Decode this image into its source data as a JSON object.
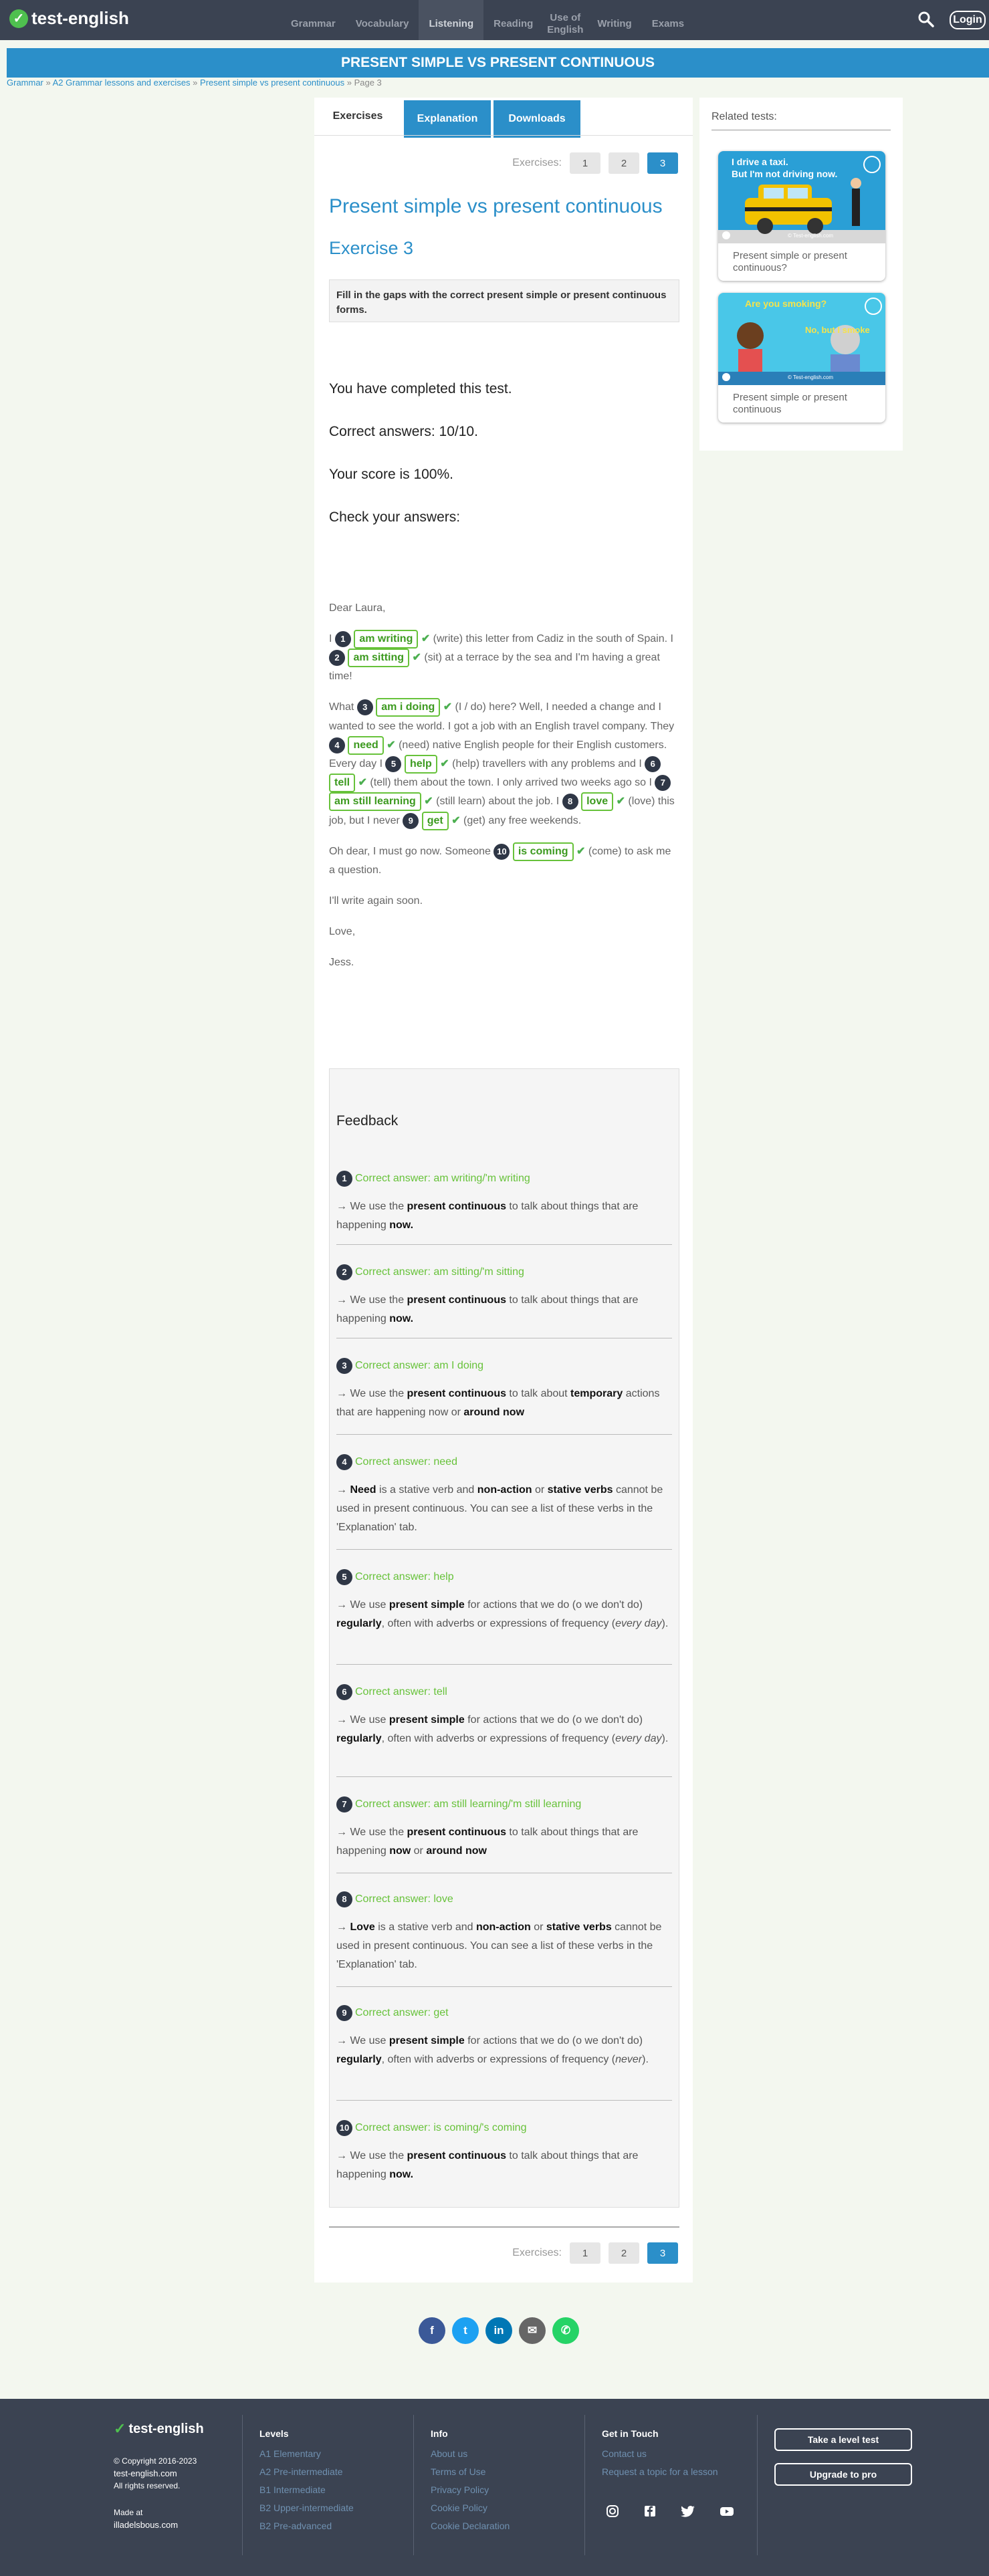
{
  "nav": {
    "logo": "test-english",
    "menu": [
      "Grammar",
      "Vocabulary",
      "Listening",
      "Reading",
      "Use of English",
      "Writing",
      "Exams"
    ],
    "active": "Listening",
    "login": "Login",
    "icons": {
      "search": "search-icon"
    }
  },
  "banner": "PRESENT SIMPLE VS PRESENT CONTINUOUS",
  "breadcrumb": {
    "items": [
      "Grammar",
      "A2 Grammar lessons and exercises",
      "Present simple vs present continuous"
    ],
    "sep": " » ",
    "current": "Page 3"
  },
  "tabs": [
    "Exercises",
    "Explanation",
    "Downloads"
  ],
  "pager": {
    "label": "Exercises:",
    "pages": [
      "1",
      "2",
      "3"
    ],
    "current": "3"
  },
  "title": "Present simple vs present continuous",
  "exercise": "Exercise 3",
  "instructions": "Fill in the gaps with the correct present simple or present continuous forms.",
  "result": {
    "completed": "You have completed this test.",
    "correct": "Correct answers: 10/10.",
    "score": "Your score is 100%.",
    "check": "Check your answers:"
  },
  "letter": {
    "greeting": "Dear Laura,",
    "p1": {
      "t1": "I ",
      "a1": "am writing",
      "h1": " (write) this letter from Cadiz in the south of Spain. I ",
      "a2": "am sitting",
      "h2": " (sit) at a terrace by the sea and I'm having a great time!"
    },
    "p2": {
      "t1": "What ",
      "a3": "am i doing",
      "h3": " (I / do) here? Well, I needed a change and I wanted to see the world. I got a job with an English travel company. They ",
      "a4": "need",
      "h4": " (need) native English people for their English customers. Every day I ",
      "a5": "help",
      "h5": " (help) travellers with any problems and I ",
      "a6": "tell",
      "h6": " (tell) them about the town. I only arrived two weeks ago so I ",
      "a7": "am still learning",
      "h7": " (still learn) about the job. I ",
      "a8": "love",
      "h8": " (love) this job, but I never ",
      "a9": "get",
      "h9": " (get) any free weekends."
    },
    "p3": {
      "t1": "Oh dear, I must go now. Someone ",
      "a10": "is coming",
      "h10": " (come) to ask me a question."
    },
    "p4": "I'll write again soon.",
    "p5": "Love,",
    "p6": "Jess."
  },
  "feedback": {
    "title": "Feedback",
    "arrow": "→",
    "items": [
      {
        "n": "1",
        "head": "Correct answer: am writing/'m writing"
      },
      {
        "n": "2",
        "head": "Correct answer: am sitting/'m sitting"
      },
      {
        "n": "3",
        "head": "Correct answer: am I doing"
      },
      {
        "n": "4",
        "head": "Correct answer: need"
      },
      {
        "n": "5",
        "head": "Correct answer: help"
      },
      {
        "n": "6",
        "head": "Correct answer: tell"
      },
      {
        "n": "7",
        "head": "Correct answer: am still learning/'m still learning"
      },
      {
        "n": "8",
        "head": "Correct answer: love"
      },
      {
        "n": "9",
        "head": "Correct answer: get"
      },
      {
        "n": "10",
        "head": "Correct answer: is coming/'s coming"
      }
    ],
    "pc_now": {
      "a": " We use the ",
      "b": "present continuous",
      "c": " to talk about things that are happening ",
      "d": "now."
    },
    "pc_temp": {
      "a": " We use the ",
      "b": "present continuous",
      "c": " to talk about ",
      "d": "temporary",
      "e": " actions that are happening now or ",
      "f": "around now"
    },
    "stative4": {
      "a": "Need",
      "b": " is a stative verb and ",
      "c": "non-action",
      "d": " or ",
      "e": "stative verbs",
      "f": " cannot be used in present continuous. You can see a list of these verbs in the 'Explanation' tab."
    },
    "ps_every": {
      "a": " We use ",
      "b": "present simple",
      "c": " for actions that we do (o we don't do) ",
      "d": "regularly",
      "e": ", often with adverbs or expressions of frequency (",
      "f": "every day",
      "g": ")."
    },
    "pc_still": {
      "a": " We use the ",
      "b": "present continuous",
      "c": " to talk about things that are happening ",
      "d": "now",
      "e": " or ",
      "f": "around now"
    },
    "stative8": {
      "a": "Love",
      "b": " is a stative verb and ",
      "c": "non-action",
      "d": " or ",
      "e": "stative verbs",
      "f": " cannot be used in present continuous. You can see a list of these verbs in the 'Explanation' tab."
    },
    "ps_never": {
      "a": " We use ",
      "b": "present simple",
      "c": " for actions that we do (o we don't do) ",
      "d": "regularly",
      "e": ", often with adverbs or expressions of frequency (",
      "f": "never",
      "g": ")."
    }
  },
  "sidebar": {
    "title": "Related tests:",
    "cards": [
      {
        "caption": "Present simple or present continuous?",
        "b1": "I drive a taxi.",
        "b2": "But I'm not driving now.",
        "credit": "© Test-english.com"
      },
      {
        "caption": "Present simple or present continuous",
        "b1": "Are you smoking?",
        "b2": "No, but I smoke",
        "credit": "© Test-english.com"
      }
    ]
  },
  "social": [
    {
      "icon": "facebook-icon",
      "glyph": "f",
      "color": "#3b5998"
    },
    {
      "icon": "twitter-icon",
      "glyph": "t",
      "color": "#1da1f2"
    },
    {
      "icon": "linkedin-icon",
      "glyph": "in",
      "color": "#0077b5"
    },
    {
      "icon": "email-icon",
      "glyph": "✉",
      "color": "#666666"
    },
    {
      "icon": "whatsapp-icon",
      "glyph": "✆",
      "color": "#25d366"
    }
  ],
  "footer": {
    "logo": "test-english",
    "copyright": "© Copyright 2016-2023",
    "domain": "test-english.com",
    "rights": "All rights reserved.",
    "made": "Made at",
    "maker": "illadelsbous.com",
    "levels": {
      "title": "Levels",
      "links": [
        "A1 Elementary",
        "A2 Pre-intermediate",
        "B1 Intermediate",
        "B2 Upper-intermediate",
        "B2 Pre-advanced"
      ]
    },
    "info": {
      "title": "Info",
      "links": [
        "About us",
        "Terms of Use",
        "Privacy Policy",
        "Cookie Policy",
        "Cookie Declaration"
      ]
    },
    "contact": {
      "title": "Get in Touch",
      "links": [
        "Contact us",
        "Request a topic for a lesson"
      ]
    },
    "social_icons": [
      "instagram-icon",
      "facebook-icon",
      "twitter-icon",
      "youtube-icon"
    ],
    "btn1": "Take a level test",
    "btn2": "Upgrade to pro"
  }
}
